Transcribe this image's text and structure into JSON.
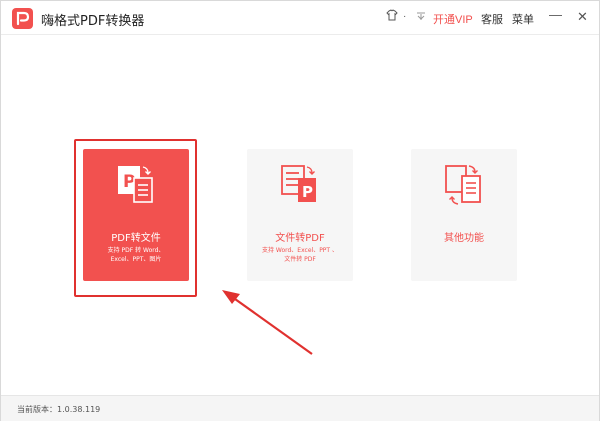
{
  "titlebar": {
    "app_title": "嗨格式PDF转换器",
    "vip_label": "开通VIP",
    "service_label": "客服",
    "menu_label": "菜单",
    "skin_icon": "shirt-icon",
    "minimize_glyph": "—",
    "close_glyph": "✕"
  },
  "cards": [
    {
      "title": "PDF转文件",
      "desc_line1": "支持 PDF 转 Word、",
      "desc_line2": "Excel、PPT、图片",
      "icon": "pdf-to-file-icon"
    },
    {
      "title": "文件转PDF",
      "desc_line1": "支持 Word、Excel、PPT 、",
      "desc_line2": "文件转 PDF",
      "icon": "file-to-pdf-icon"
    },
    {
      "title": "其他功能",
      "icon": "other-functions-icon"
    }
  ],
  "footer": {
    "version": "当前版本：1.0.38.119"
  },
  "colors": {
    "accent": "#f2514f",
    "highlight_border": "#e0312f"
  }
}
